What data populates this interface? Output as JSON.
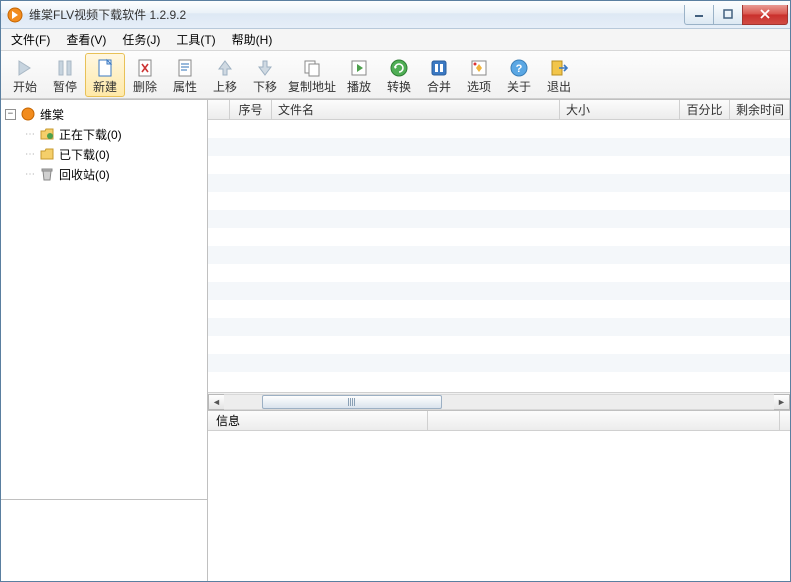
{
  "window": {
    "title": "维棠FLV视频下载软件 1.2.9.2"
  },
  "menu": {
    "file": "文件(F)",
    "view": "查看(V)",
    "task": "任务(J)",
    "tools": "工具(T)",
    "help": "帮助(H)"
  },
  "toolbar": {
    "start": "开始",
    "pause": "暂停",
    "new": "新建",
    "delete": "删除",
    "props": "属性",
    "up": "上移",
    "down": "下移",
    "copyaddr": "复制地址",
    "play": "播放",
    "convert": "转换",
    "merge": "合并",
    "options": "选项",
    "about": "关于",
    "exit": "退出"
  },
  "tree": {
    "root": "维棠",
    "downloading": "正在下载(0)",
    "downloaded": "已下载(0)",
    "recycle": "回收站(0)"
  },
  "columns": {
    "seq": "序号",
    "filename": "文件名",
    "size": "大小",
    "percent": "百分比",
    "remaining": "剩余时间"
  },
  "info": {
    "tab": "信息"
  },
  "icons": {
    "app": "app-icon",
    "minimize": "minimize-icon",
    "maximize": "maximize-icon",
    "close": "close-icon"
  }
}
